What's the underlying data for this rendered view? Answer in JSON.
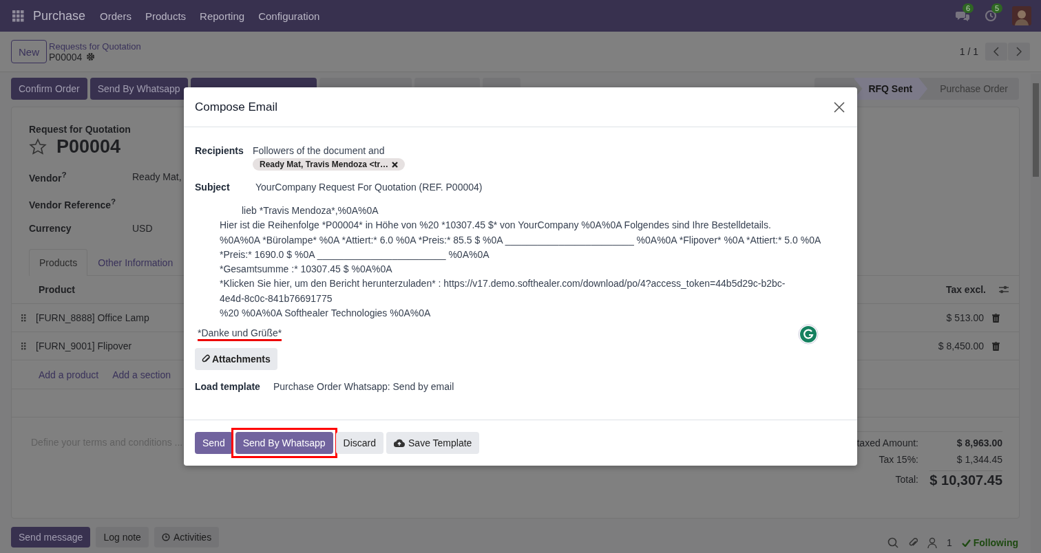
{
  "navbar": {
    "app": "Purchase",
    "menus": [
      "Orders",
      "Products",
      "Reporting",
      "Configuration"
    ],
    "messages_badge": "6",
    "activities_badge": "5"
  },
  "control_panel": {
    "new_button": "New",
    "breadcrumb": "Requests for Quotation",
    "record": "P00004",
    "pager": "1 / 1"
  },
  "actions": [
    {
      "label": "Confirm Order",
      "kind": "primary"
    },
    {
      "label": "Send By Whatsapp",
      "kind": "primary"
    },
    {
      "kind": "primary"
    },
    {
      "kind": "secondary"
    },
    {
      "kind": "secondary"
    },
    {
      "kind": "secondary"
    }
  ],
  "status_bar": [
    {
      "label": "RFQ Sent",
      "selected": true
    },
    {
      "label": "Purchase Order",
      "selected": false
    }
  ],
  "form": {
    "caption": "Request for Quotation",
    "title": "P00004",
    "starred": false,
    "fields": [
      {
        "label": "Vendor",
        "help": "?",
        "value": "Ready Mat,"
      },
      {
        "label": "Vendor Reference",
        "help": "?"
      },
      {
        "label": "Currency",
        "value": "USD"
      }
    ],
    "tabs": [
      {
        "label": "Products",
        "selected": true
      },
      {
        "label": "Other Information",
        "selected": false
      }
    ],
    "columns": [
      "Product",
      "Tax excl."
    ],
    "rows": [
      {
        "product": "[FURN_8888] Office Lamp",
        "amount": "$ 513.00"
      },
      {
        "product": "[FURN_9001] Flipover",
        "amount": "$ 8,450.00"
      }
    ],
    "add_links": [
      "Add a product",
      "Add a section"
    ],
    "terms_placeholder": "Define your terms and conditions ...",
    "totals": [
      {
        "label": "taxed Amount:",
        "value": "$ 8,963.00",
        "kind": "bold"
      },
      {
        "label": "Tax 15%:",
        "value": "$ 1,344.45",
        "kind": "plain"
      },
      {
        "label": "Total:",
        "value": "$ 10,307.45",
        "kind": "grand"
      }
    ]
  },
  "chatter": {
    "buttons": [
      {
        "label": "Send message",
        "kind": "primary"
      },
      {
        "label": "Log note",
        "kind": "secondary"
      },
      {
        "label": "Activities",
        "kind": "secondary"
      }
    ],
    "followers": "1",
    "follow": "Following"
  },
  "dialog": {
    "title": "Compose Email",
    "recipients_label": "Recipients",
    "recipients_text": "Followers of the document and",
    "tags": [
      "Ready Mat, Travis Mendoza <tr…"
    ],
    "subject_label": "Subject",
    "subject": "YourCompany Request For Quotation (REF. P00004)",
    "body": [
      "lieb *Travis Mendoza*,%0A%0A",
      "Hier ist die Reihenfolge *P00004* in Höhe von %20 *10307.45 $* von YourCompany %0A%0A Folgendes sind Ihre Bestelldetails.",
      "%0A%0A *Bürolampe* %0A *Attiert:* 6.0 %0A *Preis:* 85.5 $ %0A ________________________ %0A%0A *Flipover* %0A *Attiert:* 5.0 %0A",
      "*Preis:* 1690.0 $ %0A ________________________ %0A%0A",
      "*Gesamtsumme :* 10307.45 $ %0A%0A",
      "*Klicken Sie hier, um den Bericht herunterzuladen* : https://v17.demo.softhealer.com/download/po/4?access_token=44b5d29c-b2bc-",
      "4e4d-8c0c-841b76691775",
      "%20 %0A%0A Softhealer Technologies %0A%0A"
    ],
    "signoff": "*Danke und Grüße*",
    "signoff_underlined": true,
    "attachments": "Attachments",
    "template_label": "Load template",
    "template": "Purchase Order Whatsapp: Send by email",
    "buttons": [
      {
        "label": "Send",
        "kind": "primary",
        "highlighted": false
      },
      {
        "label": "Send By Whatsapp",
        "kind": "primary",
        "highlighted": true
      },
      {
        "label": "Discard",
        "kind": "secondary",
        "highlighted": false
      },
      {
        "label": "Save Template",
        "kind": "upload",
        "highlighted": false
      }
    ]
  }
}
